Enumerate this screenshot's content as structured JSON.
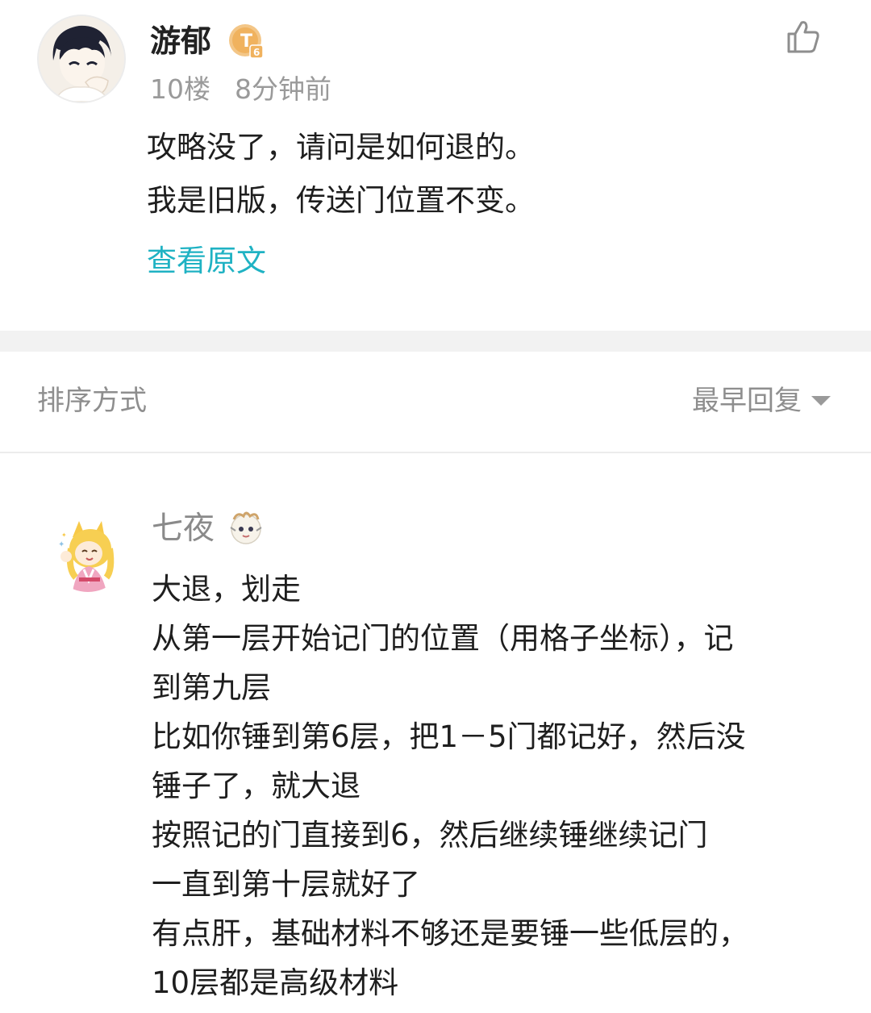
{
  "post": {
    "username": "游郁",
    "level_badge": "T6",
    "floor": "10楼",
    "time": "8分钟前",
    "lines": [
      "攻略没了，请问是如何退的。",
      "我是旧版，传送门位置不变。"
    ],
    "view_original": "查看原文",
    "like_icon": "thumbs-up-icon"
  },
  "sort": {
    "label": "排序方式",
    "value": "最早回复",
    "caret_icon": "chevron-down-icon"
  },
  "reply": {
    "username": "七夜",
    "lines": [
      "大退，划走",
      "从第一层开始记门的位置（用格子坐标），记",
      "到第九层",
      "比如你锤到第6层，把1－5门都记好，然后没",
      "锤子了，就大退",
      "按照记的门直接到6，然后继续锤继续记门",
      "一直到第十层就好了",
      "有点肝，基础材料不够还是要锤一些低层的，",
      "10层都是高级材料"
    ]
  },
  "colors": {
    "link": "#1fb2c3",
    "muted": "#9a9a9a",
    "divider": "#f2f2f2",
    "badge_gold": "#f0b25e"
  }
}
